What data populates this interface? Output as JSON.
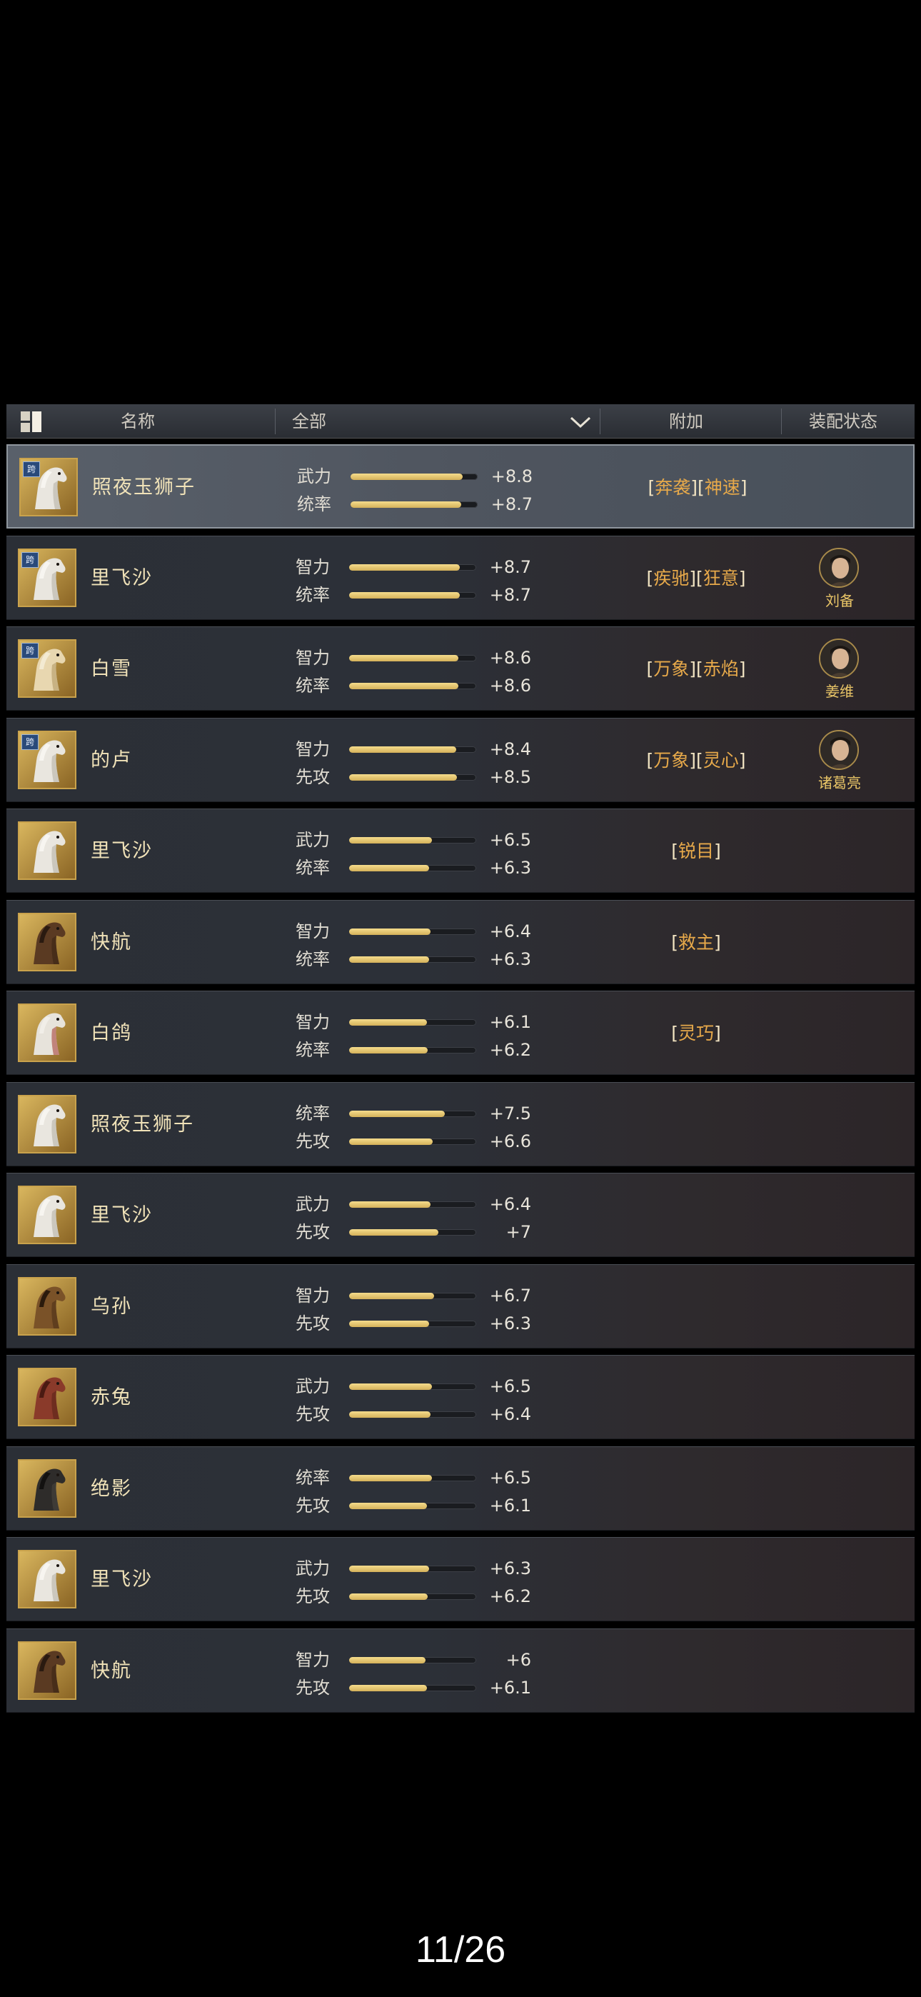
{
  "header": {
    "name_label": "名称",
    "filter_label": "全部",
    "bonus_label": "附加",
    "equip_label": "装配状态"
  },
  "rows": [
    {
      "name": "照夜玉狮子",
      "cross_badge": "跨",
      "selected": true,
      "horse": "white",
      "stats": [
        {
          "label": "武力",
          "value": "+8.8",
          "level": 8.8
        },
        {
          "label": "统率",
          "value": "+8.7",
          "level": 8.7
        }
      ],
      "bonuses": [
        "奔袭",
        "神速"
      ],
      "general": null
    },
    {
      "name": "里飞沙",
      "cross_badge": "跨",
      "selected": false,
      "horse": "white",
      "stats": [
        {
          "label": "智力",
          "value": "+8.7",
          "level": 8.7
        },
        {
          "label": "统率",
          "value": "+8.7",
          "level": 8.7
        }
      ],
      "bonuses": [
        "疾驰",
        "狂意"
      ],
      "general": "刘备"
    },
    {
      "name": "白雪",
      "cross_badge": "跨",
      "selected": false,
      "horse": "cream",
      "stats": [
        {
          "label": "智力",
          "value": "+8.6",
          "level": 8.6
        },
        {
          "label": "统率",
          "value": "+8.6",
          "level": 8.6
        }
      ],
      "bonuses": [
        "万象",
        "赤焰"
      ],
      "general": "姜维"
    },
    {
      "name": "的卢",
      "cross_badge": "跨",
      "selected": false,
      "horse": "white",
      "stats": [
        {
          "label": "智力",
          "value": "+8.4",
          "level": 8.4
        },
        {
          "label": "先攻",
          "value": "+8.5",
          "level": 8.5
        }
      ],
      "bonuses": [
        "万象",
        "灵心"
      ],
      "general": "诸葛亮"
    },
    {
      "name": "里飞沙",
      "cross_badge": "",
      "selected": false,
      "horse": "white",
      "stats": [
        {
          "label": "武力",
          "value": "+6.5",
          "level": 6.5
        },
        {
          "label": "统率",
          "value": "+6.3",
          "level": 6.3
        }
      ],
      "bonuses": [
        "锐目"
      ],
      "general": null
    },
    {
      "name": "快航",
      "cross_badge": "",
      "selected": false,
      "horse": "brown",
      "stats": [
        {
          "label": "智力",
          "value": "+6.4",
          "level": 6.4
        },
        {
          "label": "统率",
          "value": "+6.3",
          "level": 6.3
        }
      ],
      "bonuses": [
        "救主"
      ],
      "general": null
    },
    {
      "name": "白鸽",
      "cross_badge": "",
      "selected": false,
      "horse": "armored",
      "stats": [
        {
          "label": "智力",
          "value": "+6.1",
          "level": 6.1
        },
        {
          "label": "统率",
          "value": "+6.2",
          "level": 6.2
        }
      ],
      "bonuses": [
        "灵巧"
      ],
      "general": null
    },
    {
      "name": "照夜玉狮子",
      "cross_badge": "",
      "selected": false,
      "horse": "white",
      "stats": [
        {
          "label": "统率",
          "value": "+7.5",
          "level": 7.5
        },
        {
          "label": "先攻",
          "value": "+6.6",
          "level": 6.6
        }
      ],
      "bonuses": [],
      "general": null
    },
    {
      "name": "里飞沙",
      "cross_badge": "",
      "selected": false,
      "horse": "white",
      "stats": [
        {
          "label": "武力",
          "value": "+6.4",
          "level": 6.4
        },
        {
          "label": "先攻",
          "value": "+7",
          "level": 7
        }
      ],
      "bonuses": [],
      "general": null
    },
    {
      "name": "乌孙",
      "cross_badge": "",
      "selected": false,
      "horse": "bay",
      "stats": [
        {
          "label": "智力",
          "value": "+6.7",
          "level": 6.7
        },
        {
          "label": "先攻",
          "value": "+6.3",
          "level": 6.3
        }
      ],
      "bonuses": [],
      "general": null
    },
    {
      "name": "赤兔",
      "cross_badge": "",
      "selected": false,
      "horse": "red",
      "stats": [
        {
          "label": "武力",
          "value": "+6.5",
          "level": 6.5
        },
        {
          "label": "先攻",
          "value": "+6.4",
          "level": 6.4
        }
      ],
      "bonuses": [],
      "general": null
    },
    {
      "name": "绝影",
      "cross_badge": "",
      "selected": false,
      "horse": "black",
      "stats": [
        {
          "label": "统率",
          "value": "+6.5",
          "level": 6.5
        },
        {
          "label": "先攻",
          "value": "+6.1",
          "level": 6.1
        }
      ],
      "bonuses": [],
      "general": null
    },
    {
      "name": "里飞沙",
      "cross_badge": "",
      "selected": false,
      "horse": "white",
      "stats": [
        {
          "label": "武力",
          "value": "+6.3",
          "level": 6.3
        },
        {
          "label": "先攻",
          "value": "+6.2",
          "level": 6.2
        }
      ],
      "bonuses": [],
      "general": null
    },
    {
      "name": "快航",
      "cross_badge": "",
      "selected": false,
      "horse": "brown",
      "stats": [
        {
          "label": "智力",
          "value": "+6",
          "level": 6
        },
        {
          "label": "先攻",
          "value": "+6.1",
          "level": 6.1
        }
      ],
      "bonuses": [],
      "general": null
    }
  ],
  "stat_max": 10,
  "colors": {
    "bar_fill": "#e9cf7c",
    "bonus_text": "#e7a94a",
    "name_text": "#f0e2b8",
    "general_name": "#e9c567"
  },
  "page_counter": "11/26"
}
